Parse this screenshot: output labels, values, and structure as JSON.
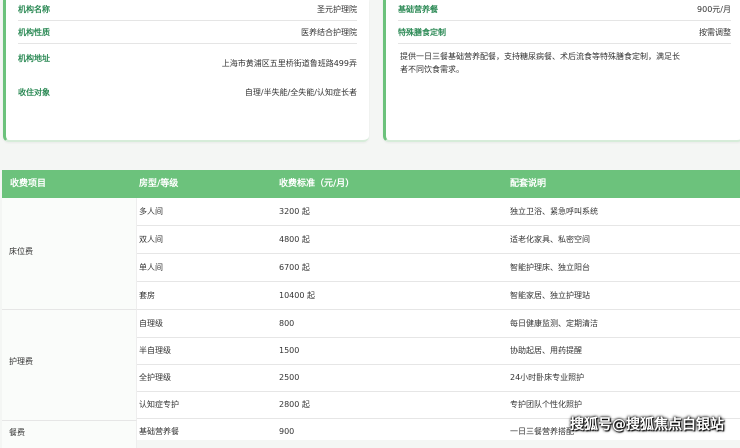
{
  "left_card": {
    "name_label": "机构名称",
    "name_value": "圣元护理院",
    "type_label": "机构性质",
    "type_value": "医养结合护理院",
    "addr_label": "机构地址",
    "addr_value": "上海市黄浦区五里桥街道鲁班路499弄",
    "target_label": "收住对象",
    "target_value": "自理/半失能/全失能/认知症长者"
  },
  "right_card": {
    "fee_label": "基础营养餐",
    "fee_value": "900元/月",
    "special_label": "特殊膳食定制",
    "special_value": "按需调整",
    "desc": "提供一日三餐基础营养配餐，支持糖尿病餐、术后流食等特殊膳食定制，满足长者不同饮食需求。"
  },
  "table": {
    "headers": [
      "收费项目",
      "房型/等级",
      "收费标准（元/月）",
      "配套说明"
    ],
    "groups": [
      "床位费",
      "护理费",
      "餐费"
    ],
    "rows": [
      {
        "level": "多人间",
        "price": "3200 起",
        "note": "独立卫浴、紧急呼叫系统"
      },
      {
        "level": "双人间",
        "price": "4800 起",
        "note": "适老化家具、私密空间"
      },
      {
        "level": "单人间",
        "price": "6700 起",
        "note": "智能护理床、独立阳台"
      },
      {
        "level": "套房",
        "price": "10400 起",
        "note": "智能家居、独立护理站"
      },
      {
        "level": "自理级",
        "price": "800",
        "note": "每日健康监测、定期清洁"
      },
      {
        "level": "半自理级",
        "price": "1500",
        "note": "协助起居、用药提醒"
      },
      {
        "level": "全护理级",
        "price": "2500",
        "note": "24小时卧床专业照护"
      },
      {
        "level": "认知症专护",
        "price": "2800 起",
        "note": "专护团队个性化照护"
      },
      {
        "level": "基础营养餐",
        "price": "900",
        "note": "一日三餐营养搭配"
      }
    ]
  },
  "watermark": "搜狐号@搜狐焦点白银站"
}
